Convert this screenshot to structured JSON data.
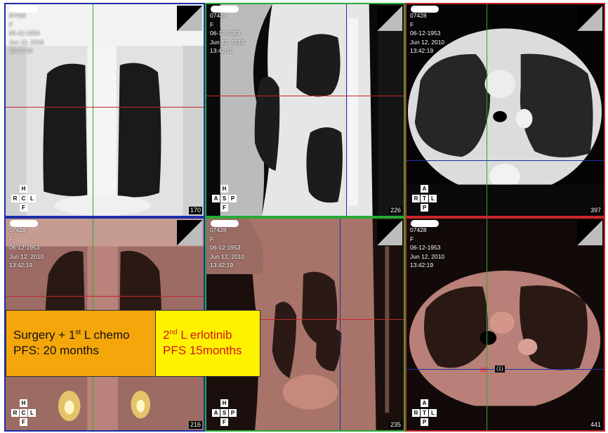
{
  "patient": {
    "id": "07428",
    "sex": "F",
    "dob": "06-12-1953",
    "study_date": "Jun 12, 2010",
    "time": "13:42:19"
  },
  "viewports": [
    {
      "view": "coronal-ct",
      "slice": "170",
      "orientation": {
        "top": "H",
        "left": "R",
        "center": "C",
        "right": "L",
        "bottom": "F"
      }
    },
    {
      "view": "sagittal-ct",
      "slice": "226",
      "orientation": {
        "top": "H",
        "left": "A",
        "center": "S",
        "right": "P",
        "bottom": "F"
      }
    },
    {
      "view": "axial-ct",
      "slice": "397",
      "orientation": {
        "top": "A",
        "left": "R",
        "center": "T",
        "right": "L",
        "bottom": "P"
      }
    },
    {
      "view": "coronal-pet",
      "slice": "216",
      "orientation": {
        "top": "H",
        "left": "R",
        "center": "C",
        "right": "L",
        "bottom": "F"
      }
    },
    {
      "view": "sagittal-pet",
      "slice": "235",
      "orientation": {
        "top": "H",
        "left": "A",
        "center": "S",
        "right": "P",
        "bottom": "F"
      }
    },
    {
      "view": "axial-pet",
      "slice": "441",
      "orientation": {
        "top": "A",
        "left": "R",
        "center": "T",
        "right": "L",
        "bottom": "P"
      }
    }
  ],
  "annotation_marker": "(1)",
  "info_box": {
    "left": {
      "line1_pre": "Surgery + 1",
      "line1_sup": "st",
      "line1_post": " L chemo",
      "line2": "PFS: 20 months"
    },
    "right": {
      "line1_pre": "2",
      "line1_sup": "nd",
      "line1_post": " L erlotinib",
      "line2": "PFS 15months"
    }
  },
  "colors": {
    "coronal_border": "#1c2fa8",
    "sagittal_border": "#2aa835",
    "axial_border": "#c8262b",
    "box_left": "#f5a60a",
    "box_right": "#fff200",
    "box_right_text": "#d4141a"
  }
}
